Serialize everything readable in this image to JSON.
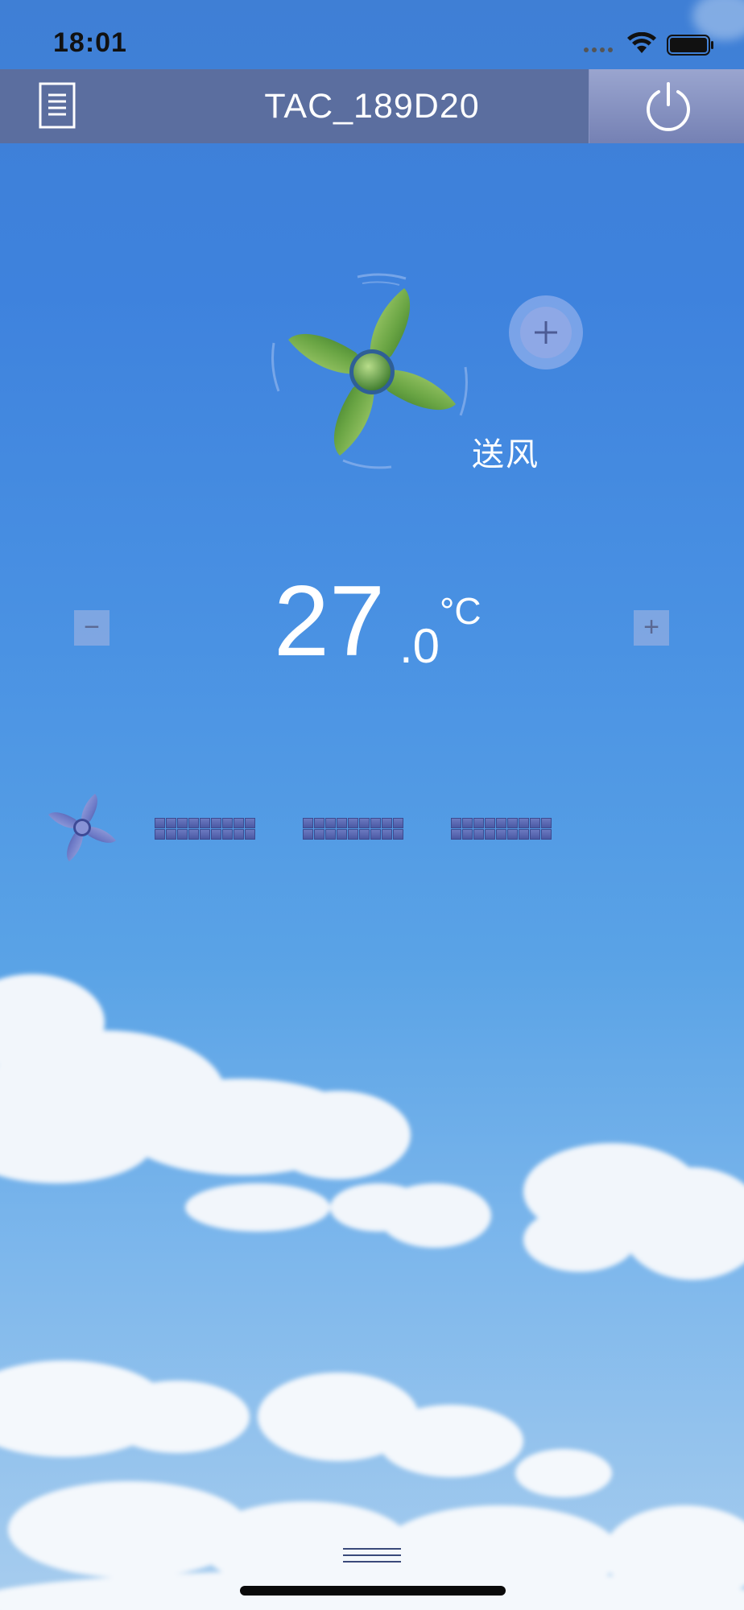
{
  "status_bar": {
    "time": "18:01"
  },
  "header": {
    "menu_icon": "document-list-icon",
    "title": "TAC_189D20",
    "power_icon": "power-icon"
  },
  "mode": {
    "icon": "pinwheel-fan-icon",
    "label": "送风",
    "next_icon": "plus-icon"
  },
  "temperature": {
    "integer": "27",
    "decimal": ".0",
    "unit": "°C",
    "decrease_label": "−",
    "increase_label": "+"
  },
  "fan_speed": {
    "icon": "fan-icon",
    "levels": 3
  },
  "bottom": {
    "handle_icon": "drawer-handle-icon"
  },
  "colors": {
    "header": "#5b6e9f",
    "sky_top": "#3f7fd5",
    "sky_bottom": "#a8cdee",
    "fan_green": "#6aa544",
    "speed_blue": "#4a58a3"
  }
}
